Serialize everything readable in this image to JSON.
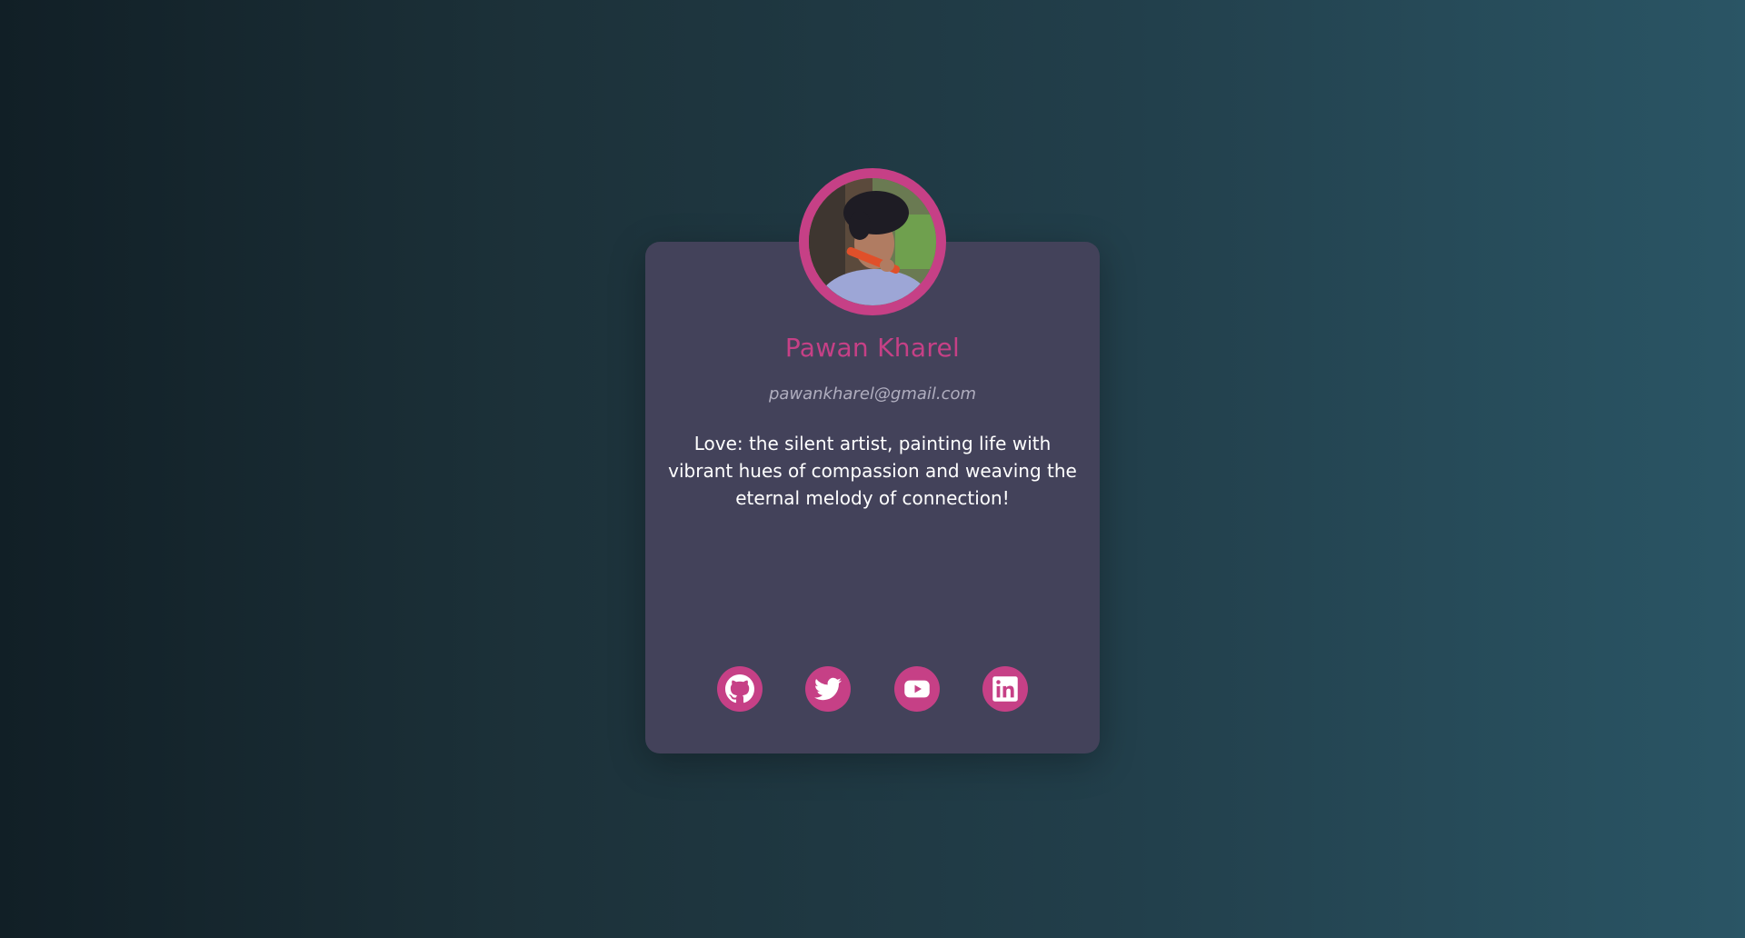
{
  "profile": {
    "name": "Pawan Kharel",
    "email": "pawankharel@gmail.com",
    "bio": "Love: the silent artist, painting life with vibrant hues of compassion and weaving the eternal melody of connection!"
  },
  "socials": [
    {
      "icon": "github-icon"
    },
    {
      "icon": "twitter-icon"
    },
    {
      "icon": "youtube-icon"
    },
    {
      "icon": "linkedin-icon"
    }
  ],
  "colors": {
    "accent": "#c64086",
    "card": "#43425a",
    "text": "#ffffff",
    "muted": "#b0aebf"
  }
}
